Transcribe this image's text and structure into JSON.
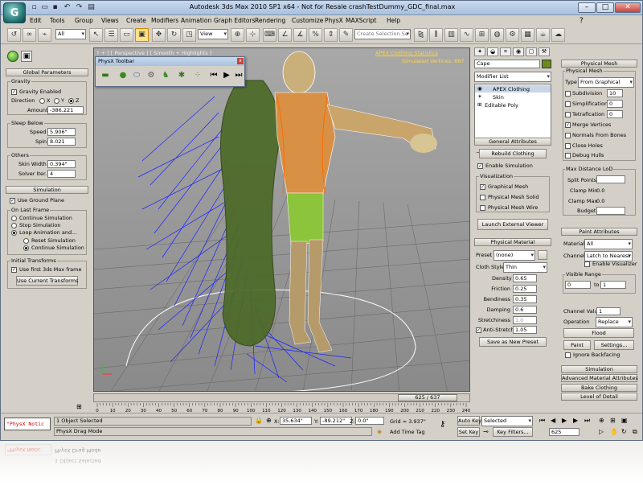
{
  "window": {
    "title": "Autodesk 3ds Max  2010 SP1 x64    - Not for Resale         crashTestDummy_GDC_final.max",
    "app_icon": "3ds-max-logo"
  },
  "menus": [
    "Edit",
    "Tools",
    "Group",
    "Views",
    "Create",
    "Modifiers",
    "Animation",
    "Graph Editors",
    "Rendering",
    "Customize",
    "PhysX",
    "MAXScript",
    "Help"
  ],
  "toolbar": {
    "filter": "All",
    "refcoord": "View",
    "selection_set_placeholder": "Create Selection Se"
  },
  "left": {
    "global_title": "Global Parameters",
    "gravity_group": "Gravity",
    "gravity_enabled": "Gravity Enabled",
    "direction": "Direction",
    "axes": [
      "X",
      "Y",
      "Z"
    ],
    "amount_label": "Amount",
    "amount": "-386.221",
    "sleep_group": "Sleep Below",
    "speed_label": "Speed",
    "speed": "5.906\"",
    "spin_label": "Spin",
    "spin": "8.021",
    "others_group": "Others",
    "skin_label": "Skin Width",
    "skin": "0.394\"",
    "solver_label": "Solver Iter.",
    "solver": "4",
    "sim_title": "Simulation",
    "ground": "Use Ground Plane",
    "last_group": "On Last Frame",
    "opt_continue": "Continue Simulation",
    "opt_stop": "Stop Simulation",
    "opt_loop": "Loop Animation and...",
    "opt_reset": "Reset Simulation",
    "opt_cont2": "Continue Simulation",
    "init_group": "Initial Transforms",
    "use_first": "Use first 3ds Max frame",
    "use_current": "Use Current Transforms"
  },
  "viewport": {
    "label": "[ + ] [ Perspective ] [ Smooth + Highlights ]",
    "stats_link": "APEX Clothing Statistics",
    "stats_text": "Simulated Vertices: 887"
  },
  "physx_toolbar": {
    "title": "PhysX Toolbar"
  },
  "cmd": {
    "object_name": "Cape",
    "modifier_list": "Modifier List",
    "stack": [
      "APEX Clothing",
      "Skin",
      "Editable Poly"
    ],
    "general_title": "General Attributes",
    "rebuild": "Rebuild Clothing",
    "enable_sim": "Enable Simulation",
    "viz_group": "Visualization",
    "viz": [
      "Graphical Mesh",
      "Physical Mesh Solid",
      "Physical Mesh Wire"
    ],
    "launch": "Launch External Viewer",
    "material_title": "Physical Material",
    "preset_label": "Preset",
    "preset": "(none)",
    "cloth_label": "Cloth Style",
    "cloth": "Thin",
    "params": [
      {
        "label": "Density",
        "value": "0.65"
      },
      {
        "label": "Friction",
        "value": "0.25"
      },
      {
        "label": "Bendiness",
        "value": "0.35"
      },
      {
        "label": "Damping",
        "value": "0.6"
      },
      {
        "label": "Stretchiness",
        "value": "1.0"
      },
      {
        "label": "Anti-Stretch",
        "value": "1.05"
      }
    ],
    "save_preset": "Save as New Preset"
  },
  "right": {
    "mesh_title": "Physical Mesh",
    "mesh_group": "Physical Mesh",
    "type_label": "Type",
    "type": "From Graphical",
    "subdivision": "Subdivision",
    "subdivision_value": "10",
    "simplification": "Simplification",
    "simplification_value": "0",
    "tetrafication": "Tetrafication",
    "tetrafication_value": "0",
    "merge": "Merge Vertices",
    "normals": "Normals From Bones",
    "close_holes": "Close Holes",
    "debug": "Debug Hulls",
    "lod_group": "Max Distance LoD",
    "split": "Split Points",
    "clamp_min": "Clamp Min",
    "clamp_min_value": "0.0",
    "clamp_max": "Clamp Max",
    "clamp_max_value": "0.0",
    "budget": "Budget",
    "paint_title": "Paint Attributes",
    "material_label": "Material",
    "material": "All",
    "channel_label": "Channel",
    "channel": "Latch to Nearest",
    "enable_viz": "Enable Visualizer",
    "range_group": "Visible Range",
    "range_from": "0",
    "range_to_label": "to",
    "range_to": "1",
    "chval_label": "Channel Value",
    "chval": "1",
    "operation_label": "Operation",
    "operation": "Replace",
    "flood": "Flood",
    "paint": "Paint",
    "settings": "Settings...",
    "ignore": "Ignore Backfacing",
    "collapsed": [
      "Simulation",
      "Advanced Material Attributes",
      "Bake Clothing",
      "Level of Detail"
    ]
  },
  "timeline": {
    "frame": "625 / 637",
    "ticks": [
      "0",
      "10",
      "20",
      "30",
      "40",
      "50",
      "60",
      "70",
      "80",
      "90",
      "100",
      "110",
      "120",
      "130",
      "140",
      "150",
      "160",
      "170",
      "180",
      "190",
      "200",
      "210",
      "220",
      "230",
      "240"
    ]
  },
  "status": {
    "maxscript": "\"PhysX Notic",
    "selected": "1 Object Selected",
    "prompt": "PhysX Drag Mode",
    "x_label": "X:",
    "x": "35.634\"",
    "y_label": "Y:",
    "y": "-89.212\"",
    "z_label": "Z:",
    "z": "0.0\"",
    "grid": "Grid = 3.937\"",
    "add_tag": "Add Time Tag",
    "autokey": "Auto Key",
    "setkey": "Set Key",
    "key_mode": "Selected",
    "key_filters": "Key Filters...",
    "frame_field": "625"
  }
}
